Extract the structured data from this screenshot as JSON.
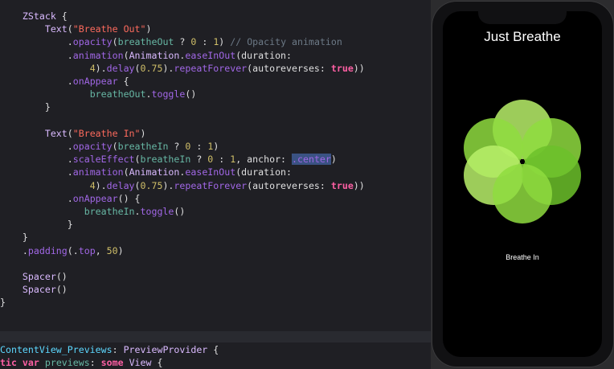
{
  "code": {
    "lines": [
      [
        {
          "t": "    ",
          "c": "t-plain"
        },
        {
          "t": "ZStack",
          "c": "t-type"
        },
        {
          "t": " {",
          "c": "t-plain"
        }
      ],
      [
        {
          "t": "        ",
          "c": "t-plain"
        },
        {
          "t": "Text",
          "c": "t-type"
        },
        {
          "t": "(",
          "c": "t-plain"
        },
        {
          "t": "\"Breathe Out\"",
          "c": "t-str"
        },
        {
          "t": ")",
          "c": "t-plain"
        }
      ],
      [
        {
          "t": "            .",
          "c": "t-plain"
        },
        {
          "t": "opacity",
          "c": "t-fn"
        },
        {
          "t": "(",
          "c": "t-plain"
        },
        {
          "t": "breatheOut",
          "c": "t-proj"
        },
        {
          "t": " ? ",
          "c": "t-plain"
        },
        {
          "t": "0",
          "c": "t-num"
        },
        {
          "t": " : ",
          "c": "t-plain"
        },
        {
          "t": "1",
          "c": "t-num"
        },
        {
          "t": ") ",
          "c": "t-plain"
        },
        {
          "t": "// Opacity animation",
          "c": "t-comment"
        }
      ],
      [
        {
          "t": "            .",
          "c": "t-plain"
        },
        {
          "t": "animation",
          "c": "t-fn"
        },
        {
          "t": "(",
          "c": "t-plain"
        },
        {
          "t": "Animation",
          "c": "t-type"
        },
        {
          "t": ".",
          "c": "t-plain"
        },
        {
          "t": "easeInOut",
          "c": "t-fn"
        },
        {
          "t": "(duration:",
          "c": "t-plain"
        }
      ],
      [
        {
          "t": "                ",
          "c": "t-plain"
        },
        {
          "t": "4",
          "c": "t-num"
        },
        {
          "t": ").",
          "c": "t-plain"
        },
        {
          "t": "delay",
          "c": "t-fn"
        },
        {
          "t": "(",
          "c": "t-plain"
        },
        {
          "t": "0.75",
          "c": "t-num"
        },
        {
          "t": ").",
          "c": "t-plain"
        },
        {
          "t": "repeatForever",
          "c": "t-fn"
        },
        {
          "t": "(autoreverses: ",
          "c": "t-plain"
        },
        {
          "t": "true",
          "c": "t-kw"
        },
        {
          "t": "))",
          "c": "t-plain"
        }
      ],
      [
        {
          "t": "            .",
          "c": "t-plain"
        },
        {
          "t": "onAppear",
          "c": "t-fn"
        },
        {
          "t": " {",
          "c": "t-plain"
        }
      ],
      [
        {
          "t": "                ",
          "c": "t-plain"
        },
        {
          "t": "breatheOut",
          "c": "t-proj"
        },
        {
          "t": ".",
          "c": "t-plain"
        },
        {
          "t": "toggle",
          "c": "t-fn"
        },
        {
          "t": "()",
          "c": "t-plain"
        }
      ],
      [
        {
          "t": "        }",
          "c": "t-plain"
        }
      ],
      [
        {
          "t": "",
          "c": "t-plain"
        }
      ],
      [
        {
          "t": "        ",
          "c": "t-plain"
        },
        {
          "t": "Text",
          "c": "t-type"
        },
        {
          "t": "(",
          "c": "t-plain"
        },
        {
          "t": "\"Breathe In\"",
          "c": "t-str"
        },
        {
          "t": ")",
          "c": "t-plain"
        }
      ],
      [
        {
          "t": "            .",
          "c": "t-plain"
        },
        {
          "t": "opacity",
          "c": "t-fn"
        },
        {
          "t": "(",
          "c": "t-plain"
        },
        {
          "t": "breatheIn",
          "c": "t-proj"
        },
        {
          "t": " ? ",
          "c": "t-plain"
        },
        {
          "t": "0",
          "c": "t-num"
        },
        {
          "t": " : ",
          "c": "t-plain"
        },
        {
          "t": "1",
          "c": "t-num"
        },
        {
          "t": ")",
          "c": "t-plain"
        }
      ],
      [
        {
          "t": "            .",
          "c": "t-plain"
        },
        {
          "t": "scaleEffect",
          "c": "t-fn"
        },
        {
          "t": "(",
          "c": "t-plain"
        },
        {
          "t": "breatheIn",
          "c": "t-proj"
        },
        {
          "t": " ? ",
          "c": "t-plain"
        },
        {
          "t": "0",
          "c": "t-num"
        },
        {
          "t": " : ",
          "c": "t-plain"
        },
        {
          "t": "1",
          "c": "t-num"
        },
        {
          "t": ", anchor: ",
          "c": "t-plain"
        },
        {
          "t": ".center",
          "c": "t-sel"
        },
        {
          "t": ")",
          "c": "t-plain"
        }
      ],
      [
        {
          "t": "            .",
          "c": "t-plain"
        },
        {
          "t": "animation",
          "c": "t-fn"
        },
        {
          "t": "(",
          "c": "t-plain"
        },
        {
          "t": "Animation",
          "c": "t-type"
        },
        {
          "t": ".",
          "c": "t-plain"
        },
        {
          "t": "easeInOut",
          "c": "t-fn"
        },
        {
          "t": "(duration:",
          "c": "t-plain"
        }
      ],
      [
        {
          "t": "                ",
          "c": "t-plain"
        },
        {
          "t": "4",
          "c": "t-num"
        },
        {
          "t": ").",
          "c": "t-plain"
        },
        {
          "t": "delay",
          "c": "t-fn"
        },
        {
          "t": "(",
          "c": "t-plain"
        },
        {
          "t": "0.75",
          "c": "t-num"
        },
        {
          "t": ").",
          "c": "t-plain"
        },
        {
          "t": "repeatForever",
          "c": "t-fn"
        },
        {
          "t": "(autoreverses: ",
          "c": "t-plain"
        },
        {
          "t": "true",
          "c": "t-kw"
        },
        {
          "t": "))",
          "c": "t-plain"
        }
      ],
      [
        {
          "t": "            .",
          "c": "t-plain"
        },
        {
          "t": "onAppear",
          "c": "t-fn"
        },
        {
          "t": "() {",
          "c": "t-plain"
        }
      ],
      [
        {
          "t": "               ",
          "c": "t-plain"
        },
        {
          "t": "breatheIn",
          "c": "t-proj"
        },
        {
          "t": ".",
          "c": "t-plain"
        },
        {
          "t": "toggle",
          "c": "t-fn"
        },
        {
          "t": "()",
          "c": "t-plain"
        }
      ],
      [
        {
          "t": "            }",
          "c": "t-plain"
        }
      ],
      [
        {
          "t": "    }",
          "c": "t-plain"
        }
      ],
      [
        {
          "t": "    .",
          "c": "t-plain"
        },
        {
          "t": "padding",
          "c": "t-fn"
        },
        {
          "t": "(.",
          "c": "t-plain"
        },
        {
          "t": "top",
          "c": "t-member"
        },
        {
          "t": ", ",
          "c": "t-plain"
        },
        {
          "t": "50",
          "c": "t-num"
        },
        {
          "t": ")",
          "c": "t-plain"
        }
      ],
      [
        {
          "t": "",
          "c": "t-plain"
        }
      ],
      [
        {
          "t": "    ",
          "c": "t-plain"
        },
        {
          "t": "Spacer",
          "c": "t-type"
        },
        {
          "t": "()",
          "c": "t-plain"
        }
      ],
      [
        {
          "t": "    ",
          "c": "t-plain"
        },
        {
          "t": "Spacer",
          "c": "t-type"
        },
        {
          "t": "()",
          "c": "t-plain"
        }
      ],
      [
        {
          "t": "}",
          "c": "t-plain"
        }
      ]
    ],
    "footer_lines": [
      [
        {
          "t": "ContentView_Previews",
          "c": "t-class"
        },
        {
          "t": ": ",
          "c": "t-plain"
        },
        {
          "t": "PreviewProvider",
          "c": "t-type"
        },
        {
          "t": " {",
          "c": "t-plain"
        }
      ],
      [
        {
          "t": "tic ",
          "c": "t-kw"
        },
        {
          "t": "var",
          "c": "t-kw"
        },
        {
          "t": " ",
          "c": "t-plain"
        },
        {
          "t": "previews",
          "c": "t-var"
        },
        {
          "t": ": ",
          "c": "t-plain"
        },
        {
          "t": "some",
          "c": "t-kw"
        },
        {
          "t": " ",
          "c": "t-plain"
        },
        {
          "t": "View",
          "c": "t-type"
        },
        {
          "t": " {",
          "c": "t-plain"
        }
      ]
    ]
  },
  "preview": {
    "title": "Just Breathe",
    "status": "Breathe In",
    "colors": {
      "petal_light": "#b8f06a",
      "petal_mid": "#8fdc3f",
      "petal_dark": "#6cc12a",
      "center": "#000000"
    }
  }
}
